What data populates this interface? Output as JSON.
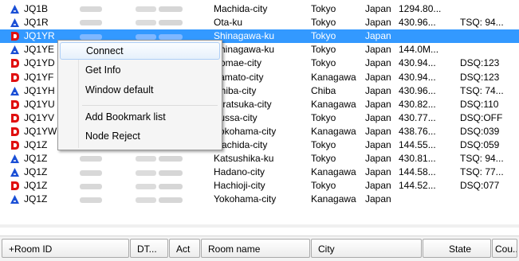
{
  "rows": [
    {
      "icon": "a",
      "id": "JQ1B",
      "name": "Machida-city",
      "pref": "Tokyo",
      "country": "Japan",
      "state": "1294.80...",
      "extra": ""
    },
    {
      "icon": "a",
      "id": "JQ1R",
      "name": "Ota-ku",
      "pref": "Tokyo",
      "country": "Japan",
      "state": "430.96...",
      "extra": "TSQ: 94..."
    },
    {
      "icon": "d",
      "id": "JQ1YR",
      "name": "Shinagawa-ku",
      "pref": "Tokyo",
      "country": "Japan",
      "state": "",
      "extra": "",
      "selected": true
    },
    {
      "icon": "a",
      "id": "JQ1YE",
      "name": "Shinagawa-ku",
      "pref": "Tokyo",
      "country": "Japan",
      "state": "144.0M...",
      "extra": ""
    },
    {
      "icon": "d",
      "id": "JQ1YD",
      "name": "Komae-city",
      "pref": "Tokyo",
      "country": "Japan",
      "state": "430.94...",
      "extra": "DSQ:123"
    },
    {
      "icon": "d",
      "id": "JQ1YF",
      "name": "Yamato-city",
      "pref": "Kanagawa",
      "country": "Japan",
      "state": "430.94...",
      "extra": "DSQ:123"
    },
    {
      "icon": "a",
      "id": "JQ1YH",
      "name": "Chiba-city",
      "pref": "Chiba",
      "country": "Japan",
      "state": "430.96...",
      "extra": "TSQ: 74..."
    },
    {
      "icon": "d",
      "id": "JQ1YU",
      "name": "Hiratsuka-city",
      "pref": "Kanagawa",
      "country": "Japan",
      "state": "430.82...",
      "extra": "DSQ:110"
    },
    {
      "icon": "d",
      "id": "JQ1YV",
      "name": "Fussa-city",
      "pref": "Tokyo",
      "country": "Japan",
      "state": "430.77...",
      "extra": "DSQ:OFF"
    },
    {
      "icon": "d",
      "id": "JQ1YW",
      "name": "Yokohama-city",
      "pref": "Kanagawa",
      "country": "Japan",
      "state": "438.76...",
      "extra": "DSQ:039"
    },
    {
      "icon": "d",
      "id": "JQ1Z",
      "name": "Machida-city",
      "pref": "Tokyo",
      "country": "Japan",
      "state": "144.55...",
      "extra": "DSQ:059"
    },
    {
      "icon": "a",
      "id": "JQ1Z",
      "name": "Katsushika-ku",
      "pref": "Tokyo",
      "country": "Japan",
      "state": "430.81...",
      "extra": "TSQ: 94..."
    },
    {
      "icon": "a",
      "id": "JQ1Z",
      "name": "Hadano-city",
      "pref": "Kanagawa",
      "country": "Japan",
      "state": "144.58...",
      "extra": "TSQ: 77..."
    },
    {
      "icon": "d",
      "id": "JQ1Z",
      "name": "Hachioji-city",
      "pref": "Tokyo",
      "country": "Japan",
      "state": "144.52...",
      "extra": "DSQ:077"
    },
    {
      "icon": "a",
      "id": "JQ1Z",
      "name": "Yokohama-city",
      "pref": "Kanagawa",
      "country": "Japan",
      "state": "",
      "extra": ""
    }
  ],
  "context_menu": {
    "connect": "Connect",
    "get_info": "Get Info",
    "window_default": "Window default",
    "add_bookmark": "Add Bookmark list",
    "node_reject": "Node Reject"
  },
  "header": {
    "room_id": "+Room ID",
    "dt": "DT...",
    "act": "Act",
    "room_name": "Room name",
    "city": "City",
    "state": "State",
    "cou": "Cou..."
  },
  "colors": {
    "selection": "#3399ff",
    "icon_a": "#1a4fd6",
    "icon_d": "#e01010"
  }
}
